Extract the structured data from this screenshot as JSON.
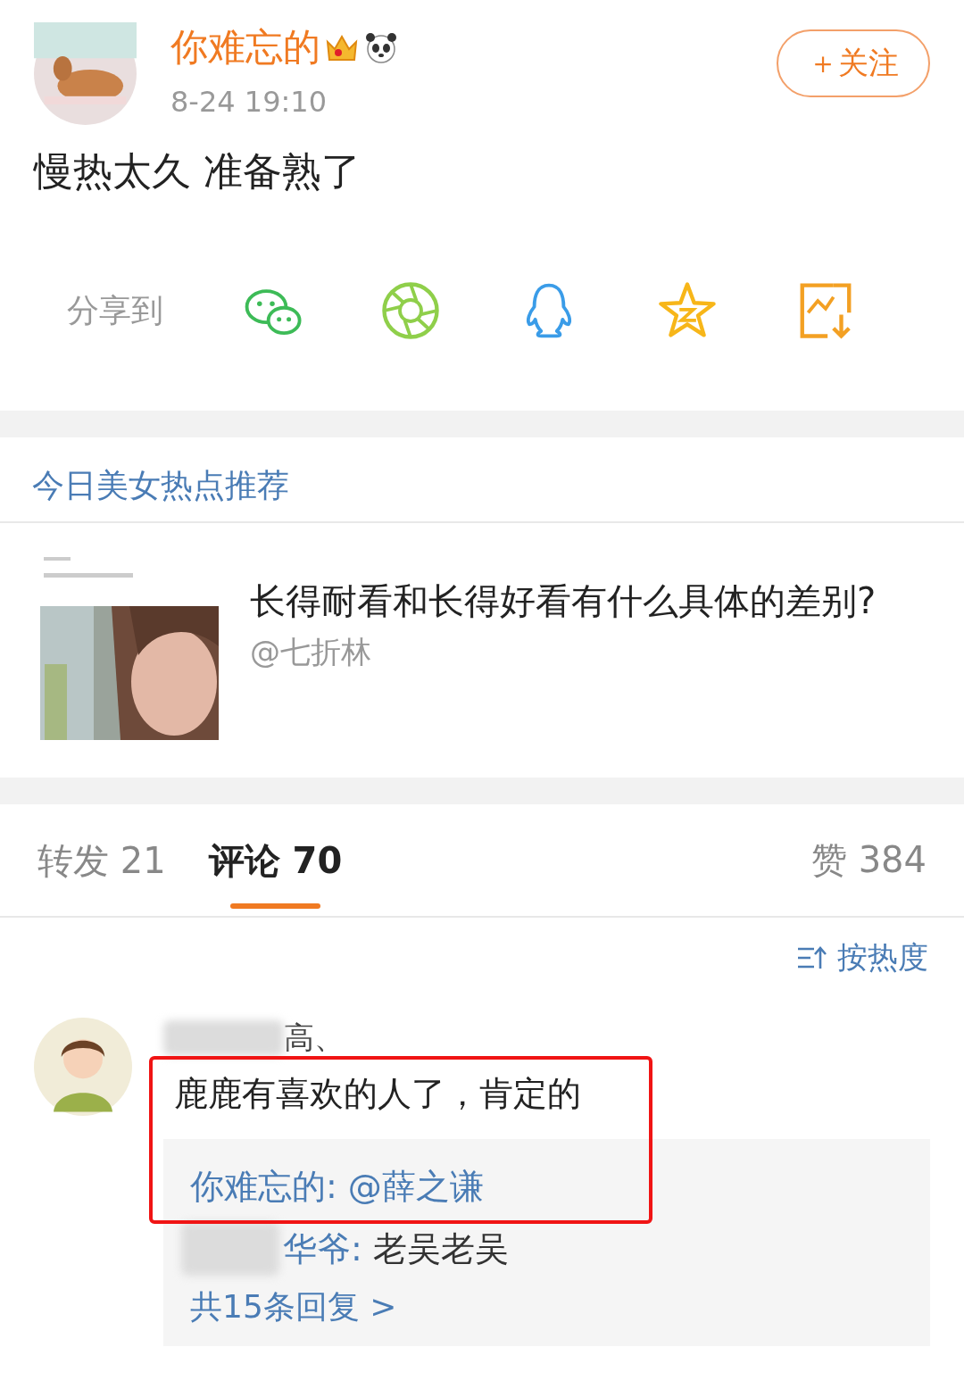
{
  "post": {
    "author": "你难忘的",
    "time": "8-24 19:10",
    "follow_button": "＋关注",
    "text": "慢热太久 准备熟了"
  },
  "share": {
    "label": "分享到",
    "targets": [
      {
        "kind": "wechat"
      },
      {
        "kind": "moments"
      },
      {
        "kind": "qq"
      },
      {
        "kind": "qzone"
      },
      {
        "kind": "save"
      }
    ]
  },
  "recommend": {
    "title": "今日美女热点推荐",
    "item": {
      "kind": "picture",
      "title": "长得耐看和长得好看有什么具体的差别?",
      "author": "@七折林"
    }
  },
  "tabs": [
    {
      "label": "转发",
      "count": "21",
      "selected": false
    },
    {
      "label": "评论",
      "count": "70",
      "selected": true
    }
  ],
  "likes": {
    "label": "赞",
    "count": "384"
  },
  "sort": "按热度",
  "comments": [
    {
      "name": "高、",
      "name_blurred": true,
      "text": "鹿鹿有喜欢的人了，肯定的",
      "marked": true,
      "replies": [
        {
          "name": "你难忘的:",
          "text": "@薛之谦",
          "mention": true,
          "blurred": false
        },
        {
          "name": "华爷:",
          "text": "老吴老吴",
          "mention": false,
          "blurred": true
        }
      ],
      "more": "共15条回复 >"
    }
  ]
}
